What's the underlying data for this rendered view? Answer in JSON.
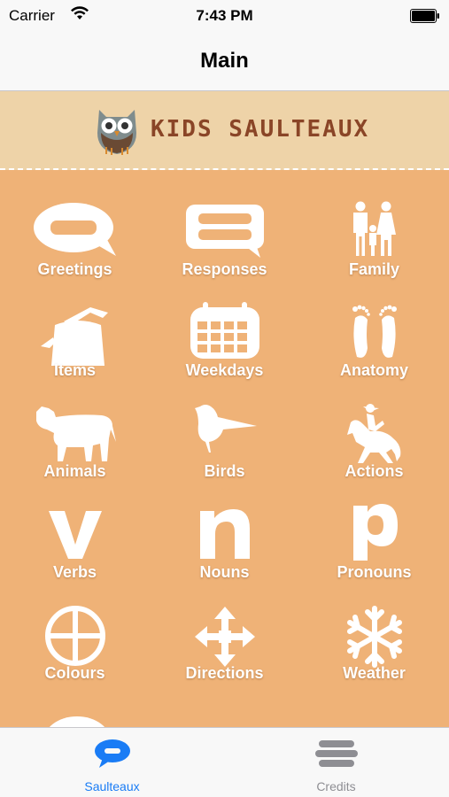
{
  "status_bar": {
    "carrier": "Carrier",
    "time": "7:43 PM"
  },
  "nav": {
    "title": "Main"
  },
  "banner": {
    "brand": "KIDS SAULTEAUX"
  },
  "grid": {
    "items": [
      {
        "label": "Greetings",
        "icon": "speech-bubble-icon"
      },
      {
        "label": "Responses",
        "icon": "responses-icon"
      },
      {
        "label": "Family",
        "icon": "family-icon"
      },
      {
        "label": "Items",
        "icon": "kettle-icon"
      },
      {
        "label": "Weekdays",
        "icon": "calendar-icon"
      },
      {
        "label": "Anatomy",
        "icon": "footprints-icon"
      },
      {
        "label": "Animals",
        "icon": "cow-icon"
      },
      {
        "label": "Birds",
        "icon": "bird-icon"
      },
      {
        "label": "Actions",
        "icon": "horse-rider-icon"
      },
      {
        "label": "Verbs",
        "icon": "letter-v-icon"
      },
      {
        "label": "Nouns",
        "icon": "letter-n-icon"
      },
      {
        "label": "Pronouns",
        "icon": "letter-p-icon"
      },
      {
        "label": "Colours",
        "icon": "circle-cross-icon"
      },
      {
        "label": "Directions",
        "icon": "directions-arrows-icon"
      },
      {
        "label": "Weather",
        "icon": "snowflake-icon"
      }
    ]
  },
  "tabs": [
    {
      "label": "Saulteaux",
      "icon": "chat-bubble-icon",
      "active": true
    },
    {
      "label": "Credits",
      "icon": "list-icon",
      "active": false
    }
  ],
  "colors": {
    "background": "#efb277",
    "banner": "#eed3a8",
    "tab_active": "#1a7cf5",
    "tab_inactive": "#8e8e93",
    "brand_text": "#8a4527"
  }
}
